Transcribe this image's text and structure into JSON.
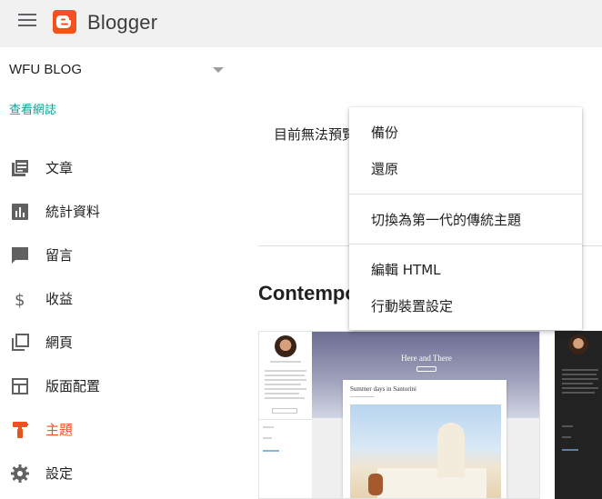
{
  "header": {
    "brand": "Blogger",
    "menu_icon": "hamburger-menu-icon",
    "logo_icon": "blogger-logo-icon",
    "brand_color": "#f4511e"
  },
  "sidebar": {
    "blog_name": "WFU BLOG",
    "view_blog": "查看網誌",
    "items": [
      {
        "label": "文章",
        "icon": "posts-icon"
      },
      {
        "label": "統計資料",
        "icon": "stats-icon"
      },
      {
        "label": "留言",
        "icon": "comments-icon"
      },
      {
        "label": "收益",
        "icon": "earnings-icon"
      },
      {
        "label": "網頁",
        "icon": "pages-icon"
      },
      {
        "label": "版面配置",
        "icon": "layout-icon"
      },
      {
        "label": "主題",
        "icon": "theme-icon",
        "active": true
      },
      {
        "label": "設定",
        "icon": "settings-icon"
      }
    ],
    "active_color": "#e8541f",
    "link_color": "#0f9d96"
  },
  "main": {
    "preview_message": "目前無法預覽",
    "section_title": "Contempo",
    "theme_preview": {
      "hero_title": "Here and There",
      "post_title": "Summer days in Santorini"
    }
  },
  "menu": {
    "items": [
      {
        "label": "備份"
      },
      {
        "label": "還原"
      },
      {
        "label": "切換為第一代的傳統主題"
      },
      {
        "label": "編輯 HTML"
      },
      {
        "label": "行動裝置設定"
      }
    ]
  }
}
